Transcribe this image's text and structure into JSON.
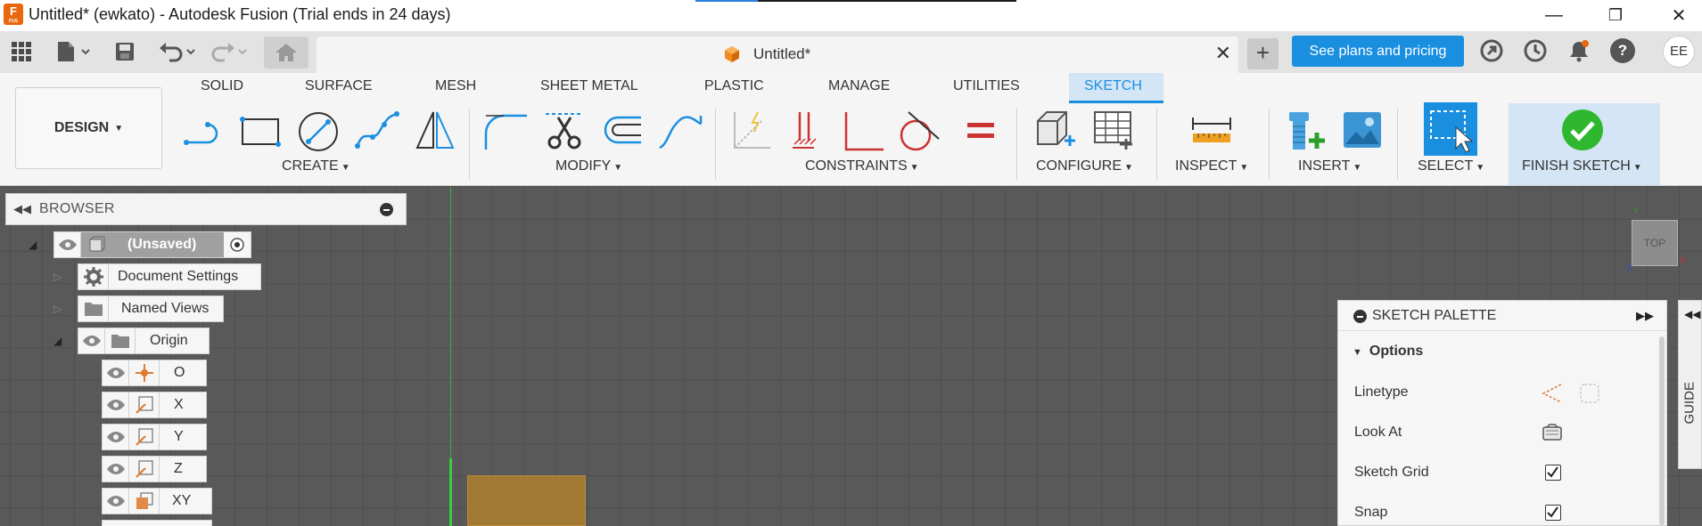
{
  "window": {
    "title": "Untitled* (ewkato) - Autodesk Fusion (Trial ends in 24 days)",
    "logo_letter": "F",
    "logo_caption": "FUS",
    "minimize_glyph": "—",
    "restore_glyph": "❐",
    "close_glyph": "✕"
  },
  "doc_tab": {
    "label": "Untitled*",
    "close_glyph": "✕"
  },
  "toolbar": {
    "plus_glyph": "+",
    "plans_label": "See plans and pricing",
    "avatar_initials": "EE",
    "help_glyph": "?"
  },
  "ribbon": {
    "workspace": "DESIGN",
    "tabs": [
      "SOLID",
      "SURFACE",
      "MESH",
      "SHEET METAL",
      "PLASTIC",
      "MANAGE",
      "UTILITIES",
      "SKETCH"
    ],
    "active_tab": "SKETCH",
    "groups": [
      "CREATE",
      "MODIFY",
      "CONSTRAINTS",
      "CONFIGURE",
      "INSPECT",
      "INSERT",
      "SELECT",
      "FINISH SKETCH"
    ],
    "accent": "#1a8fe0"
  },
  "browser": {
    "title": "BROWSER",
    "root": "(Unsaved)",
    "items": [
      "Document Settings",
      "Named Views",
      "Origin"
    ],
    "origin_items": [
      "O",
      "X",
      "Y",
      "Z",
      "XY"
    ]
  },
  "sketch_palette": {
    "title": "SKETCH PALETTE",
    "section": "Options",
    "rows": [
      {
        "label": "Linetype"
      },
      {
        "label": "Look At"
      },
      {
        "label": "Sketch Grid",
        "checked": true
      },
      {
        "label": "Snap",
        "checked": true
      }
    ]
  },
  "guide_label": "GUIDE",
  "viewcube": {
    "face": "TOP",
    "y": "Y",
    "x": "X",
    "z": "Z"
  }
}
